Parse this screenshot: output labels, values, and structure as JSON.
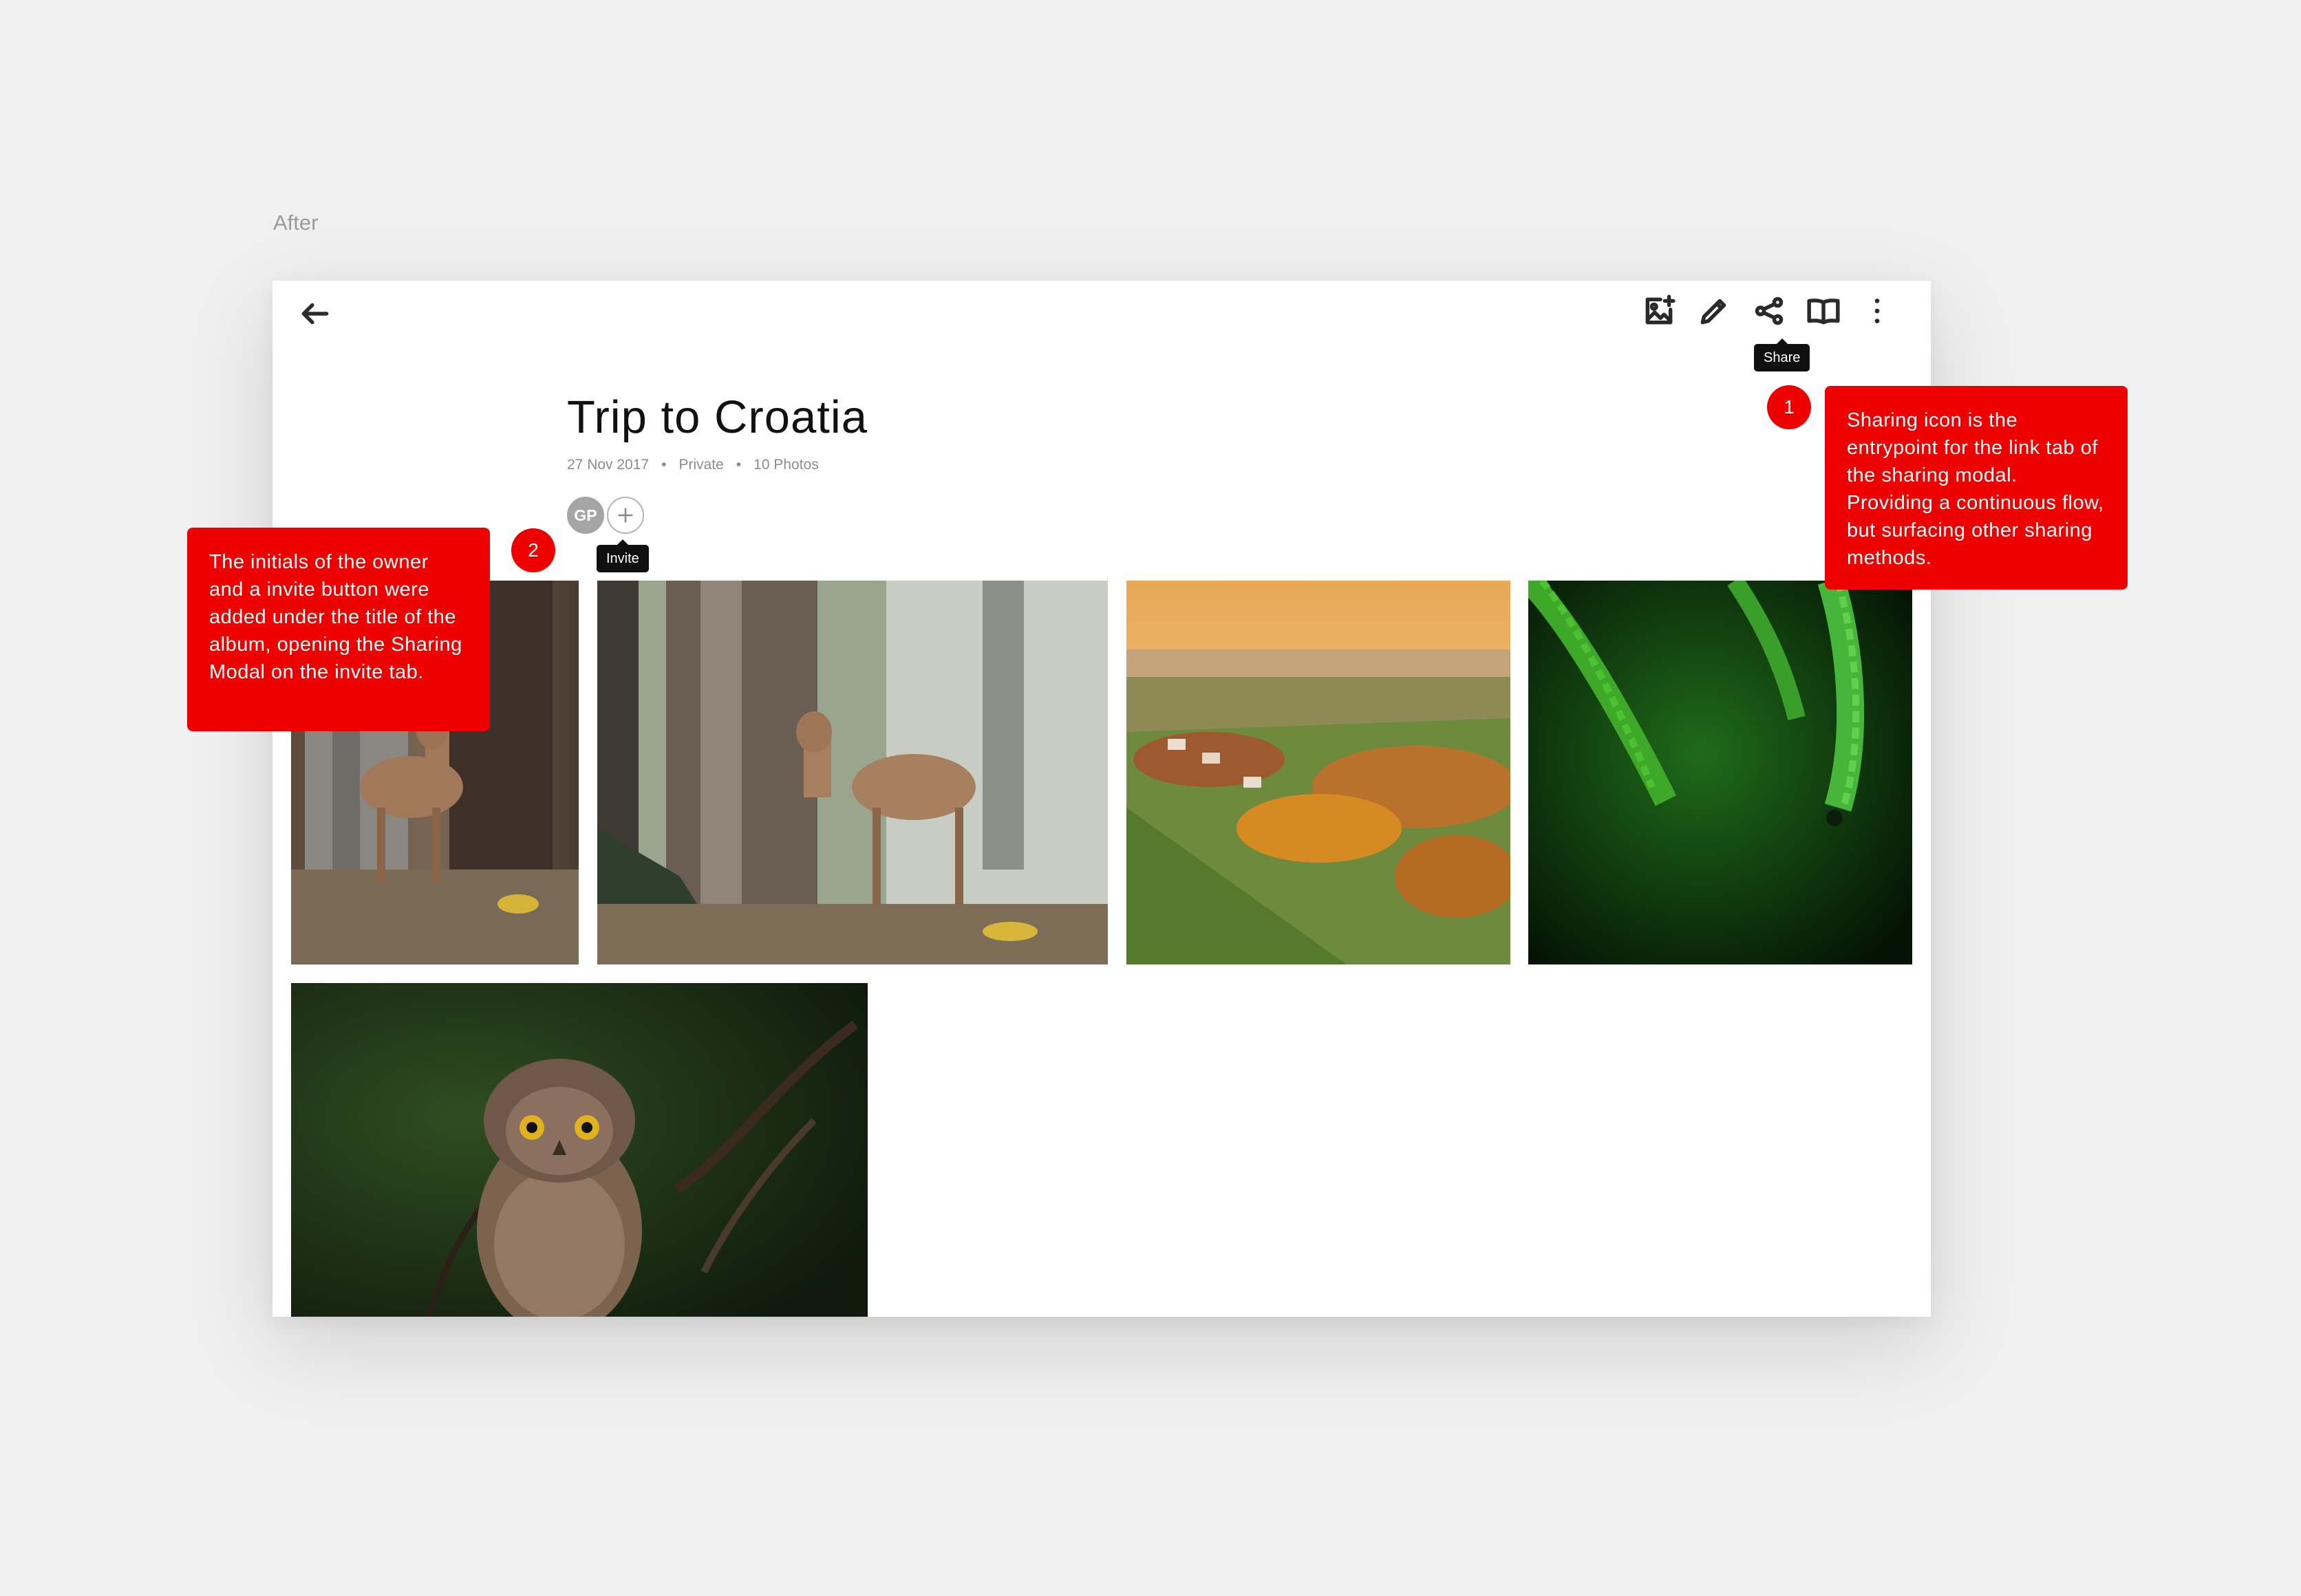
{
  "page_label": "After",
  "toolbar": {
    "back_icon": "arrow-left-icon",
    "icons": [
      "add-photo-icon",
      "pencil-icon",
      "share-icon",
      "book-icon",
      "more-vertical-icon"
    ],
    "share_tooltip": "Share"
  },
  "album": {
    "title": "Trip to Croatia",
    "date": "27 Nov 2017",
    "privacy": "Private",
    "count": "10 Photos",
    "owner_initials": "GP",
    "invite_tooltip": "Invite"
  },
  "photos": [
    {
      "subject": "deer by tree trunk"
    },
    {
      "subject": "deer by tree trunk"
    },
    {
      "subject": "autumn village landscape"
    },
    {
      "subject": "green fern leaves"
    },
    {
      "subject": "young owl on branch"
    }
  ],
  "annotations": [
    {
      "number": "1",
      "text": "Sharing icon is the entrypoint for the link tab of the sharing modal. Providing a continuous flow, but surfacing other sharing methods."
    },
    {
      "number": "2",
      "text": "The initials of the owner and a invite button were added under the title of the album, opening the Sharing Modal on the invite tab."
    }
  ],
  "colors": {
    "annotation": "#ee0000",
    "tooltip": "#0f0f0f",
    "avatar": "#a5a5a5",
    "background": "#f0f0f0"
  }
}
